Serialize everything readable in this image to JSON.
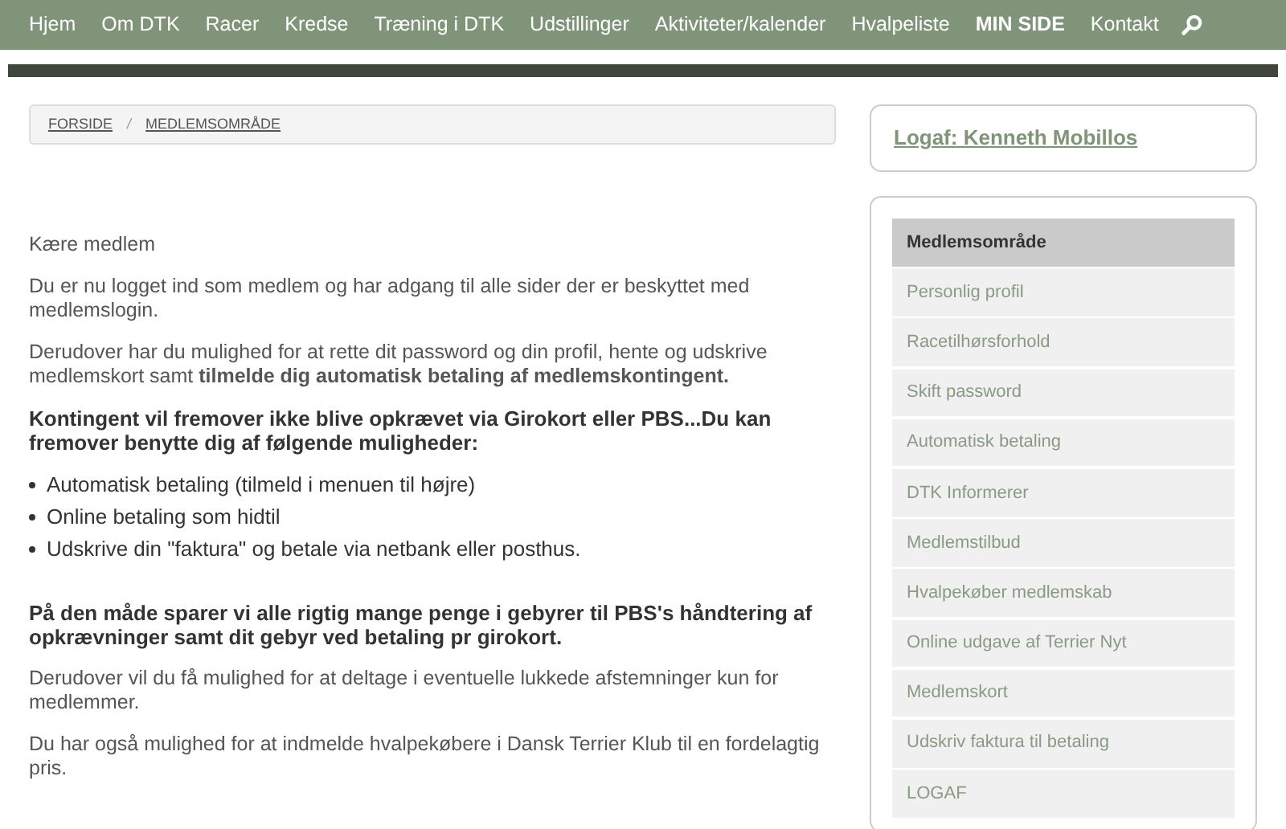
{
  "nav": {
    "items": [
      {
        "label": "Hjem",
        "selected": false
      },
      {
        "label": "Om DTK",
        "selected": false
      },
      {
        "label": "Racer",
        "selected": false
      },
      {
        "label": "Kredse",
        "selected": false
      },
      {
        "label": "Træning i DTK",
        "selected": false
      },
      {
        "label": "Udstillinger",
        "selected": false
      },
      {
        "label": "Aktiviteter/kalender",
        "selected": false
      },
      {
        "label": "Hvalpeliste",
        "selected": false
      },
      {
        "label": "MIN SIDE",
        "selected": true
      },
      {
        "label": "Kontakt",
        "selected": false
      }
    ]
  },
  "breadcrumb": {
    "items": [
      "FORSIDE",
      "MEDLEMSOMRÅDE"
    ],
    "separator": "/"
  },
  "content": [
    {
      "kind": "text",
      "text": "Kære medlem"
    },
    {
      "kind": "text",
      "text": "Du er nu logget ind som medlem og har adgang til alle sider der er beskyttet med medlemslogin."
    },
    {
      "kind": "text",
      "text": "Derudover har du mulighed for at rette dit password og din profil, hente og udskrive medlemskort samt **tilmelde dig automatisk betaling af medlemskontingent.**"
    },
    {
      "kind": "bold",
      "text": "Kontingent vil fremover ikke blive opkrævet via Girokort eller PBS...Du kan fremover benytte dig af følgende muligheder:"
    },
    {
      "kind": "list",
      "items": [
        "Automatisk betaling (tilmeld i menuen til højre)",
        "Online betaling som hidtil",
        "Udskrive din \"faktura\" og betale via netbank eller posthus."
      ]
    },
    {
      "kind": "bold",
      "text": "På den måde sparer vi alle rigtig mange penge i gebyrer til PBS's håndtering af opkrævninger samt dit gebyr ved betaling pr girokort."
    },
    {
      "kind": "text",
      "text": "Derudover vil du få mulighed for at deltage i eventuelle lukkede afstemninger kun for medlemmer."
    },
    {
      "kind": "text",
      "text": "Du har også mulighed for at indmelde hvalpekøbere i Dansk Terrier Klub til en fordelagtig pris."
    }
  ],
  "sidebar": {
    "logout_link": "Logaf: Kenneth Mobillos",
    "menu": [
      {
        "label": "Medlemsområde",
        "selected": true
      },
      {
        "label": "Personlig profil",
        "selected": false
      },
      {
        "label": "Racetilhørsforhold",
        "selected": false
      },
      {
        "label": "Skift password",
        "selected": false
      },
      {
        "label": "Automatisk betaling",
        "selected": false
      },
      {
        "label": "DTK Informerer",
        "selected": false
      },
      {
        "label": "Medlemstilbud",
        "selected": false
      },
      {
        "label": "Hvalpekøber medlemskab",
        "selected": false
      },
      {
        "label": "Online udgave af Terrier Nyt",
        "selected": false
      },
      {
        "label": "Medlemskort",
        "selected": false
      },
      {
        "label": "Udskriv faktura til betaling",
        "selected": false
      },
      {
        "label": "LOGAF",
        "selected": false
      }
    ]
  }
}
